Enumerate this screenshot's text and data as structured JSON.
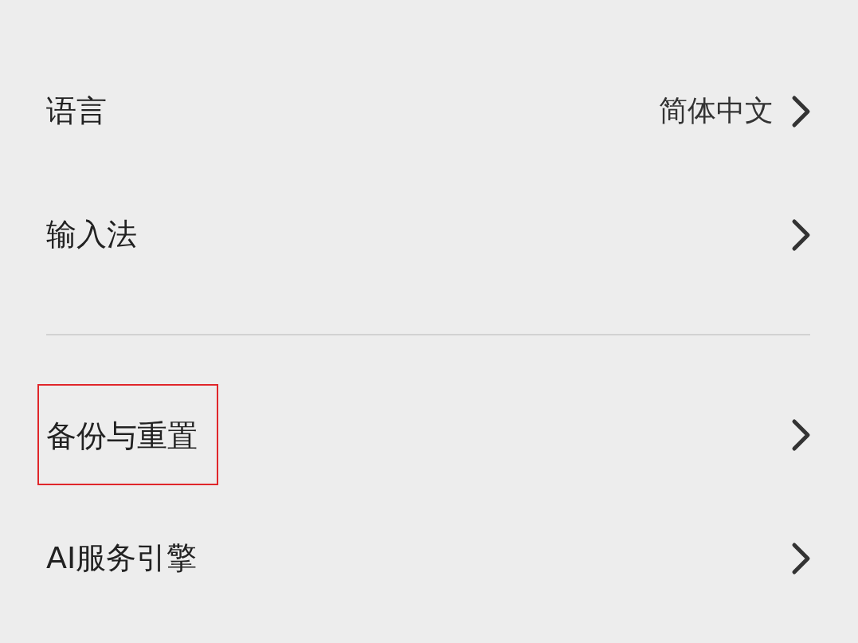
{
  "sections": [
    {
      "items": [
        {
          "label": "语言",
          "value": "简体中文",
          "highlighted": false
        },
        {
          "label": "输入法",
          "highlighted": false
        }
      ]
    },
    {
      "items": [
        {
          "label": "备份与重置",
          "highlighted": true
        },
        {
          "label": "AI服务引擎",
          "highlighted": false
        }
      ]
    }
  ]
}
